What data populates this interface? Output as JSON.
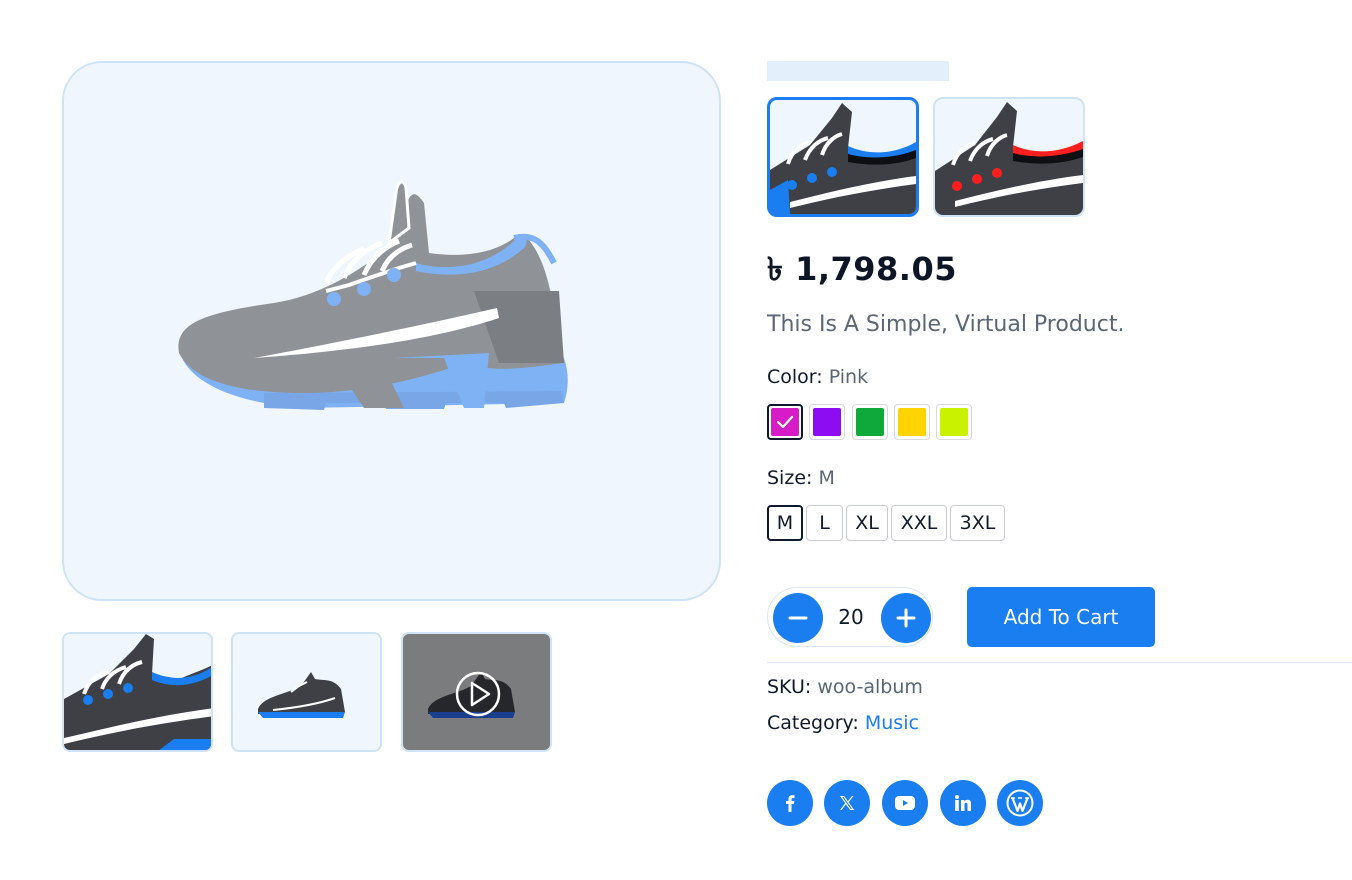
{
  "product": {
    "price": "৳ 1,798.05",
    "description": "This Is A Simple, Virtual Product."
  },
  "gallery": {
    "thumbnails": [
      {
        "name": "Shoe closeup"
      },
      {
        "name": "Shoe side view"
      },
      {
        "name": "Shoe video"
      }
    ]
  },
  "variants": [
    {
      "accent": "#1a7ef0",
      "selected": true
    },
    {
      "accent": "#ff1f1f",
      "selected": false
    }
  ],
  "color": {
    "label": "Color:",
    "selected": "Pink",
    "options": [
      {
        "hex": "#d61cc7",
        "selected": true
      },
      {
        "hex": "#8d0df2",
        "selected": false
      },
      {
        "hex": "#0fa83a",
        "selected": false
      },
      {
        "hex": "#ffd400",
        "selected": false
      },
      {
        "hex": "#c8f200",
        "selected": false
      }
    ]
  },
  "size": {
    "label": "Size:",
    "selected": "M",
    "options": [
      "M",
      "L",
      "XL",
      "XXL",
      "3XL"
    ]
  },
  "quantity": {
    "value": "20",
    "minus_icon": "minus-icon",
    "plus_icon": "plus-icon"
  },
  "cart": {
    "label": "Add To Cart"
  },
  "meta": {
    "sku_label": "SKU:",
    "sku_value": "woo-album",
    "category_label": "Category:",
    "category_value": "Music"
  },
  "social": [
    "facebook-icon",
    "x-icon",
    "youtube-icon",
    "linkedin-icon",
    "wordpress-icon"
  ],
  "colors": {
    "accent": "#1a7ef0",
    "panel_bg": "#f0f6fd",
    "panel_border": "#cfe3f7"
  }
}
